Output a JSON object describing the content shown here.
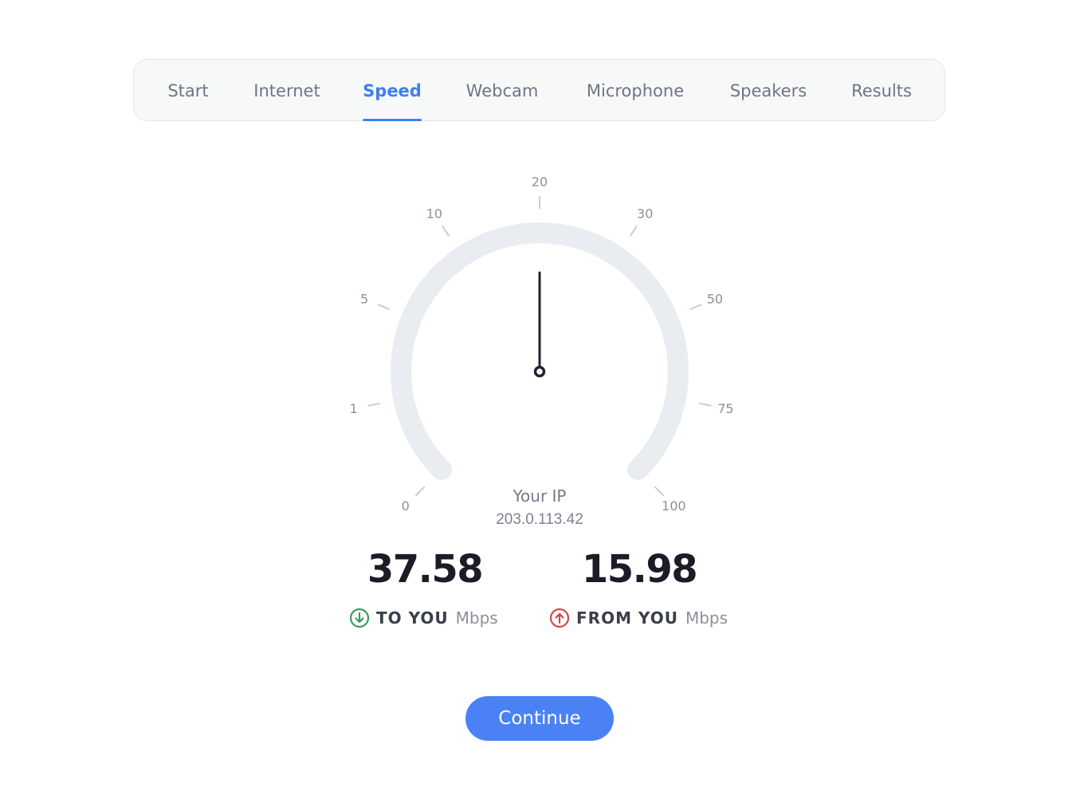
{
  "nav": {
    "tabs": [
      {
        "label": "Start",
        "active": false
      },
      {
        "label": "Internet",
        "active": false
      },
      {
        "label": "Speed",
        "active": true
      },
      {
        "label": "Webcam",
        "active": false
      },
      {
        "label": "Microphone",
        "active": false
      },
      {
        "label": "Speakers",
        "active": false
      },
      {
        "label": "Results",
        "active": false
      }
    ]
  },
  "gauge": {
    "tick_labels": [
      "0",
      "1",
      "5",
      "10",
      "20",
      "30",
      "50",
      "75",
      "100"
    ],
    "needle_fraction": 0.5
  },
  "ip": {
    "label": "Your IP",
    "value": "203.0.113.42"
  },
  "download": {
    "value": "37.58",
    "label": "TO YOU",
    "unit": "Mbps",
    "icon": "arrow-down-circle-icon",
    "color": "#3c9a5f"
  },
  "upload": {
    "value": "15.98",
    "label": "FROM YOU",
    "unit": "Mbps",
    "icon": "arrow-up-circle-icon",
    "color": "#d04848"
  },
  "continue_button": {
    "label": "Continue"
  },
  "colors": {
    "accent": "#3f7ef0",
    "button": "#4a82f5",
    "gauge_track": "#e9ecf0",
    "needle": "#1f2330"
  }
}
